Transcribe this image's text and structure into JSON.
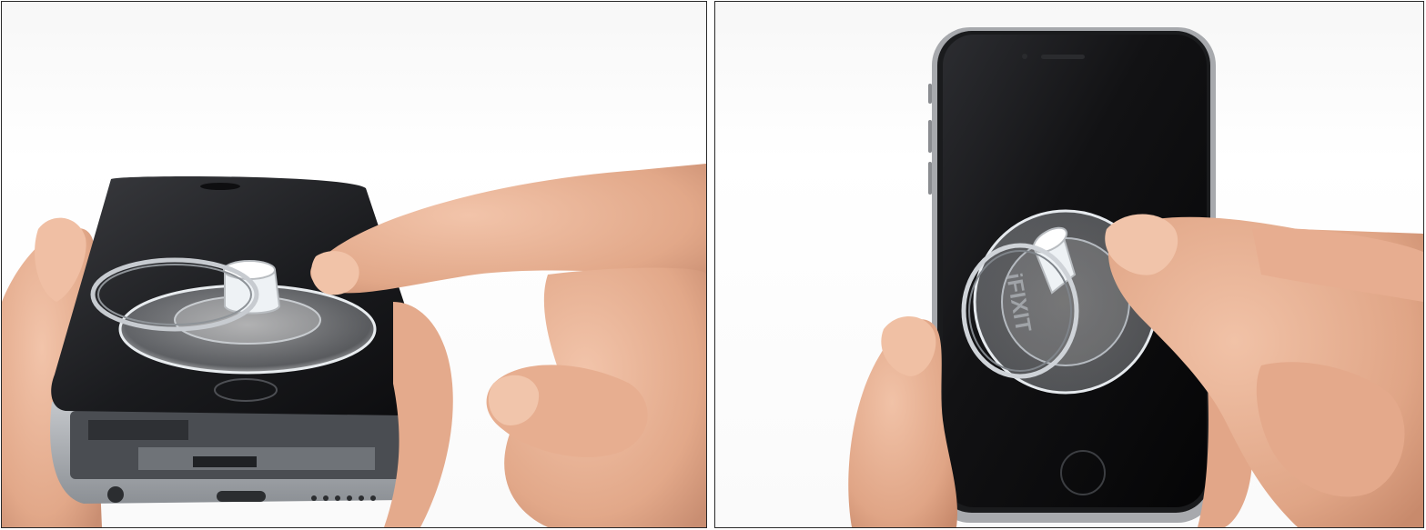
{
  "photos": [
    {
      "id_label": "left",
      "suction_cup_brand": "",
      "colors": {
        "phone_glass": "#1c1c1e",
        "phone_body": "#9ea2a7",
        "skin": "#e9b59a",
        "skin_shadow": "#c98e72"
      }
    },
    {
      "id_label": "right",
      "suction_cup_brand": "iFIXIT",
      "colors": {
        "phone_glass": "#0d0d0f",
        "phone_body": "#a7a9ad",
        "skin": "#e8b294",
        "skin_shadow": "#c88a6c"
      }
    }
  ]
}
